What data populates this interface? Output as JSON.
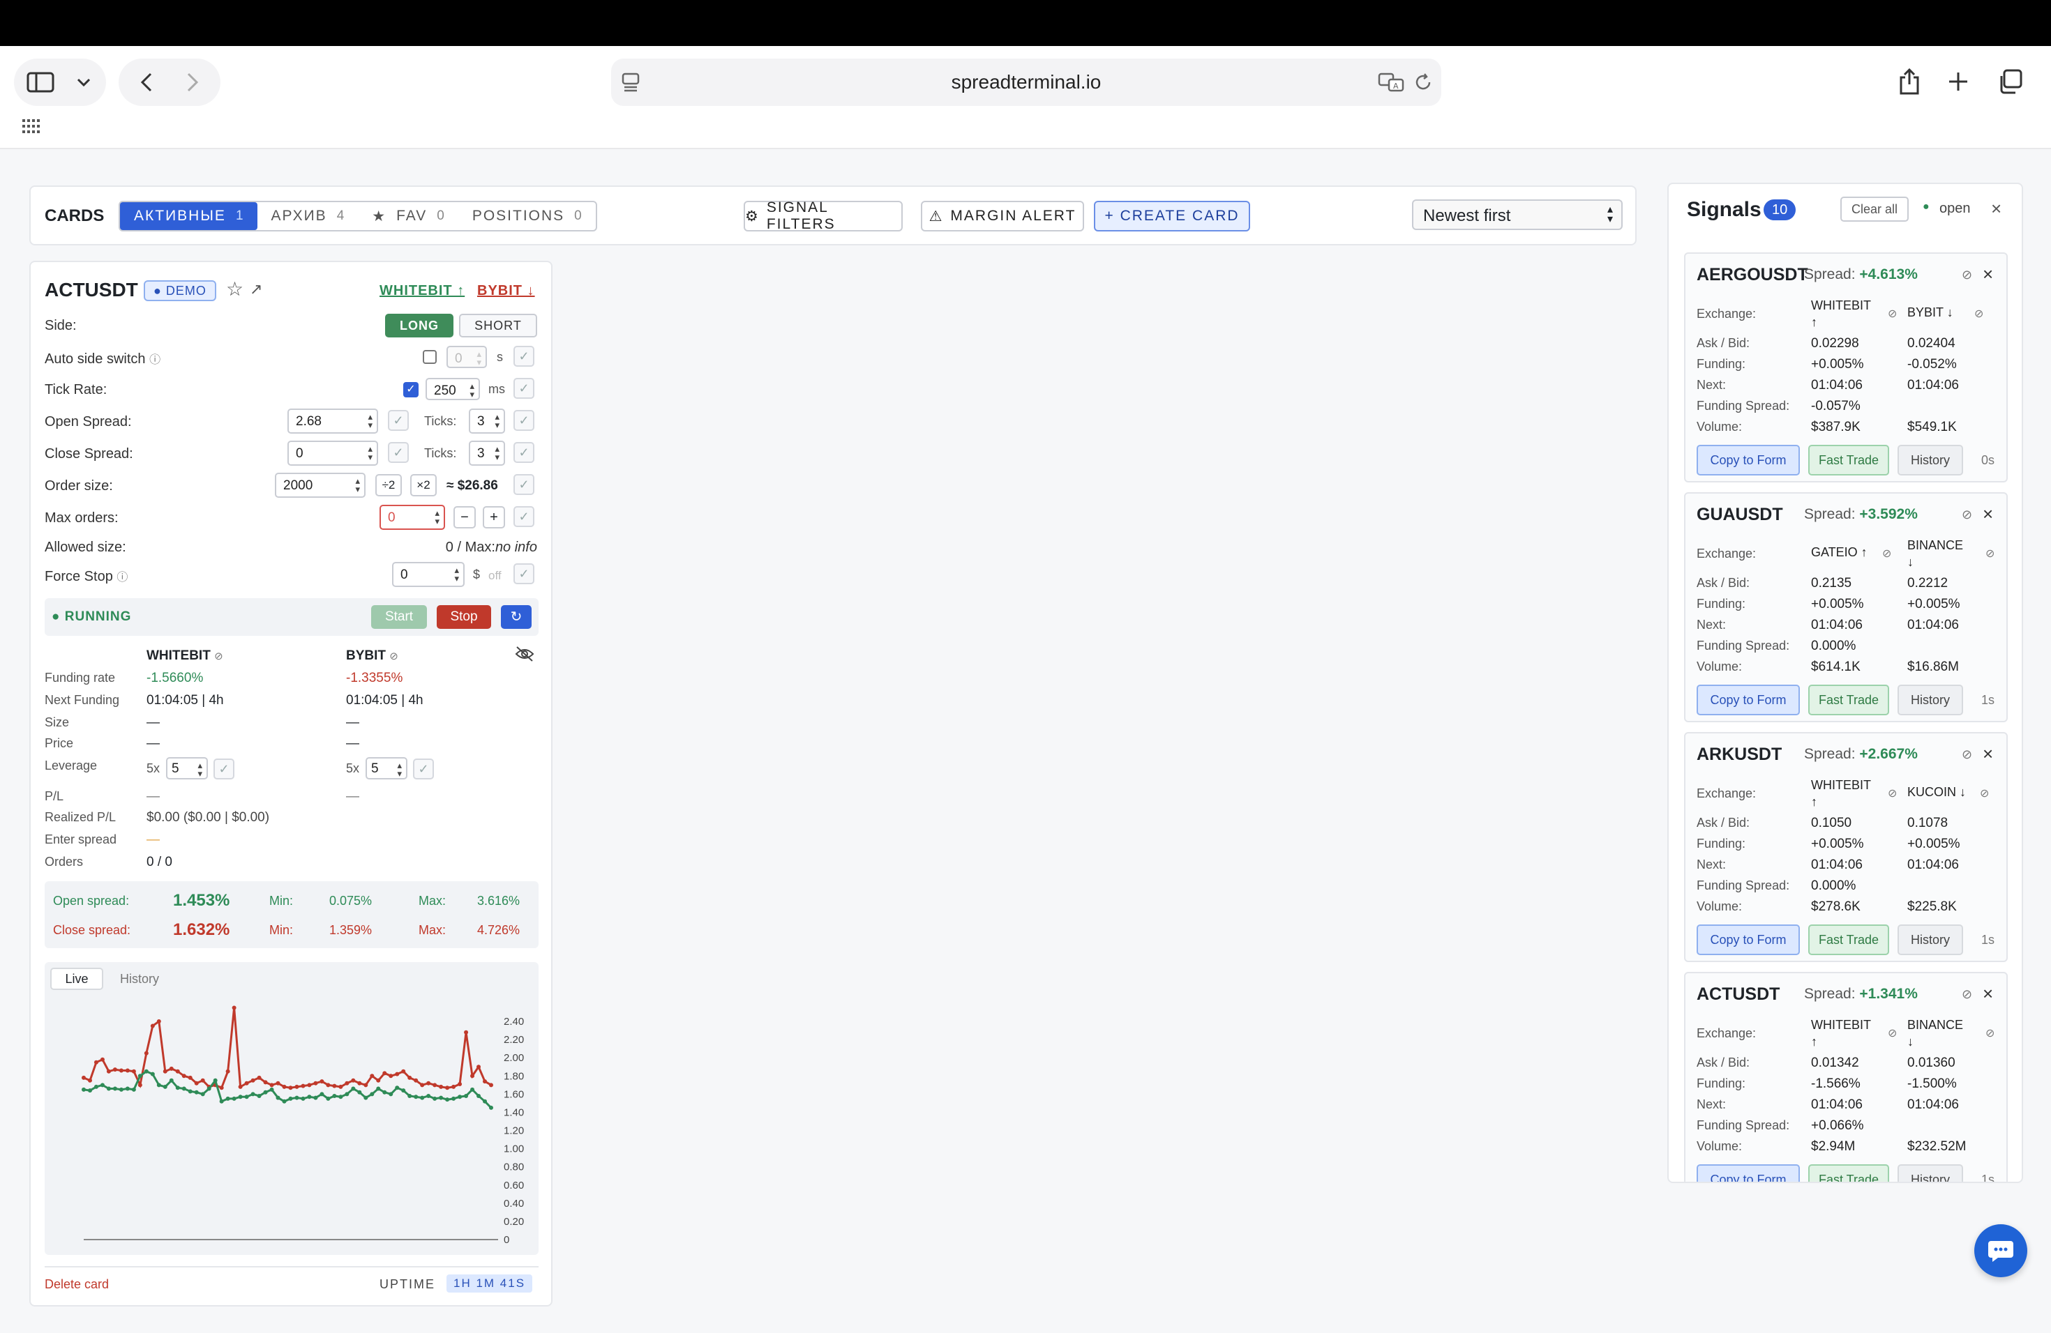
{
  "browser": {
    "url": "spreadterminal.io"
  },
  "cards_bar": {
    "title": "CARDS",
    "tabs": [
      {
        "label": "АКТИВНЫЕ",
        "count": "1"
      },
      {
        "label": "АРХИВ",
        "count": "4"
      },
      {
        "label": "FAV",
        "count": "0"
      },
      {
        "label": "POSITIONS",
        "count": "0"
      }
    ],
    "signal_filters": "SIGNAL FILTERS",
    "margin_alert": "MARGIN ALERT",
    "create_card": "+ CREATE CARD",
    "sort": "Newest first"
  },
  "card": {
    "symbol": "ACTUSDT",
    "demo": "DEMO",
    "ex_long": "WHITEBIT ↑",
    "ex_short": "BYBIT ↓",
    "side_label": "Side:",
    "long": "LONG",
    "short": "SHORT",
    "auto_switch_label": "Auto side switch",
    "auto_switch_value": "0",
    "auto_switch_unit": "s",
    "tick_rate_label": "Tick Rate:",
    "tick_rate_value": "250",
    "tick_rate_unit": "ms",
    "open_spread_label": "Open Spread:",
    "open_spread_value": "2.68",
    "close_spread_label": "Close Spread:",
    "close_spread_value": "0",
    "ticks_label": "Ticks:",
    "open_ticks": "3",
    "close_ticks": "3",
    "order_size_label": "Order size:",
    "order_size_value": "2000",
    "div2": "÷2",
    "mul2": "×2",
    "order_size_usd": "≈ $26.86",
    "max_orders_label": "Max orders:",
    "max_orders_value": "0",
    "minus": "−",
    "plus": "+",
    "allowed_size_label": "Allowed size:",
    "allowed_size_value": "0 / Max:",
    "allowed_size_info": "no info",
    "force_stop_label": "Force Stop",
    "force_stop_value": "0",
    "force_stop_unit": "$",
    "force_stop_state": "off",
    "status": "RUNNING",
    "start": "Start",
    "stop": "Stop",
    "ex1": "WHITEBIT",
    "ex2": "BYBIT",
    "rows": [
      {
        "label": "Funding rate",
        "v1": "-1.5660%",
        "v2": "-1.3355%"
      },
      {
        "label": "Next Funding",
        "v1": "01:04:05 | 4h",
        "v2": "01:04:05 | 4h"
      },
      {
        "label": "Size",
        "v1": "—",
        "v2": "—"
      },
      {
        "label": "Price",
        "v1": "—",
        "v2": "—"
      },
      {
        "label": "Leverage",
        "v1": "5x",
        "v2": "5x"
      },
      {
        "label": "P/L",
        "v1": "—",
        "v2": "—"
      },
      {
        "label": "Realized P/L",
        "v1": "$0.00 ($0.00 | $0.00)",
        "v2": ""
      },
      {
        "label": "Enter spread",
        "v1": "—",
        "v2": ""
      },
      {
        "label": "Orders",
        "v1": "0 / 0",
        "v2": ""
      }
    ],
    "lev1": "5",
    "lev2": "5",
    "open_spread_stat": {
      "label": "Open spread:",
      "value": "1.453%",
      "min_label": "Min:",
      "min": "0.075%",
      "max_label": "Max:",
      "max": "3.616%"
    },
    "close_spread_stat": {
      "label": "Close spread:",
      "value": "1.632%",
      "min_label": "Min:",
      "min": "1.359%",
      "max_label": "Max:",
      "max": "4.726%"
    },
    "chart_tabs": [
      "Live",
      "History"
    ],
    "delete": "Delete card",
    "uptime_label": "UPTIME",
    "uptime_value": "1H 1M 41S"
  },
  "chart_data": {
    "type": "line",
    "ylim": [
      0,
      2.5
    ],
    "yticks": [
      "2.40",
      "2.20",
      "2.00",
      "1.80",
      "1.60",
      "1.40",
      "1.20",
      "1.00",
      "0.80",
      "0.60",
      "0.40",
      "0.20",
      "0"
    ],
    "series": [
      {
        "color": "#c0392b",
        "values": [
          1.78,
          1.75,
          1.95,
          1.98,
          1.85,
          1.87,
          1.86,
          1.86,
          1.85,
          1.7,
          2.05,
          2.35,
          2.4,
          1.85,
          1.88,
          1.85,
          1.8,
          1.78,
          1.72,
          1.75,
          1.68,
          1.7,
          1.67,
          1.85,
          2.55,
          1.68,
          1.72,
          1.75,
          1.78,
          1.73,
          1.7,
          1.72,
          1.68,
          1.67,
          1.68,
          1.69,
          1.7,
          1.72,
          1.74,
          1.7,
          1.69,
          1.68,
          1.72,
          1.75,
          1.72,
          1.7,
          1.8,
          1.75,
          1.83,
          1.8,
          1.82,
          1.85,
          1.78,
          1.75,
          1.7,
          1.72,
          1.7,
          1.68,
          1.67,
          1.68,
          1.71,
          2.28,
          1.8,
          1.9,
          1.74,
          1.7
        ]
      },
      {
        "color": "#2e8b57",
        "values": [
          1.65,
          1.64,
          1.68,
          1.7,
          1.66,
          1.66,
          1.65,
          1.66,
          1.65,
          1.8,
          1.85,
          1.82,
          1.7,
          1.68,
          1.75,
          1.67,
          1.66,
          1.63,
          1.62,
          1.6,
          1.66,
          1.75,
          1.52,
          1.55,
          1.55,
          1.57,
          1.57,
          1.6,
          1.58,
          1.62,
          1.65,
          1.56,
          1.52,
          1.55,
          1.56,
          1.55,
          1.57,
          1.56,
          1.6,
          1.55,
          1.58,
          1.57,
          1.6,
          1.66,
          1.62,
          1.56,
          1.6,
          1.66,
          1.62,
          1.6,
          1.67,
          1.64,
          1.58,
          1.57,
          1.56,
          1.58,
          1.55,
          1.56,
          1.54,
          1.55,
          1.57,
          1.58,
          1.65,
          1.58,
          1.52,
          1.45
        ]
      }
    ]
  },
  "signals": {
    "title": "Signals",
    "count": "10",
    "clear_all": "Clear all",
    "open_label": "open",
    "labels": {
      "exchange": "Exchange:",
      "askbid": "Ask / Bid:",
      "funding": "Funding:",
      "next": "Next:",
      "funding_spread": "Funding Spread:",
      "volume": "Volume:"
    },
    "buttons": {
      "copy": "Copy to Form",
      "fast": "Fast Trade",
      "history": "History"
    },
    "items": [
      {
        "symbol": "AERGOUSDT",
        "spread_label": "Spread:",
        "spread": "+4.613%",
        "ex1": "WHITEBIT",
        "ex1_arrow": "↑",
        "ex2": "BYBIT ↓",
        "ex2_arrow": "",
        "ask": "0.02298",
        "bid": "0.02404",
        "f1": "+0.005%",
        "f2": "-0.052%",
        "n1": "01:04:06",
        "n2": "01:04:06",
        "fs": "-0.057%",
        "v1": "$387.9K",
        "v2": "$549.1K",
        "age": "0s"
      },
      {
        "symbol": "GUAUSDT",
        "spread_label": "Spread:",
        "spread": "+3.592%",
        "ex1": "GATEIO ↑",
        "ex1_arrow": "",
        "ex2": "BINANCE",
        "ex2_arrow": "↓",
        "ask": "0.2135",
        "bid": "0.2212",
        "f1": "+0.005%",
        "f2": "+0.005%",
        "n1": "01:04:06",
        "n2": "01:04:06",
        "fs": "0.000%",
        "v1": "$614.1K",
        "v2": "$16.86M",
        "age": "1s"
      },
      {
        "symbol": "ARKUSDT",
        "spread_label": "Spread:",
        "spread": "+2.667%",
        "ex1": "WHITEBIT",
        "ex1_arrow": "↑",
        "ex2": "KUCOIN ↓",
        "ex2_arrow": "",
        "ask": "0.1050",
        "bid": "0.1078",
        "f1": "+0.005%",
        "f2": "+0.005%",
        "n1": "01:04:06",
        "n2": "01:04:06",
        "fs": "0.000%",
        "v1": "$278.6K",
        "v2": "$225.8K",
        "age": "1s"
      },
      {
        "symbol": "ACTUSDT",
        "spread_label": "Spread:",
        "spread": "+1.341%",
        "ex1": "WHITEBIT",
        "ex1_arrow": "↑",
        "ex2": "BINANCE",
        "ex2_arrow": "↓",
        "ask": "0.01342",
        "bid": "0.01360",
        "f1": "-1.566%",
        "f2": "-1.500%",
        "n1": "01:04:06",
        "n2": "01:04:06",
        "fs": "+0.066%",
        "v1": "$2.94M",
        "v2": "$232.52M",
        "age": "1s"
      }
    ]
  }
}
